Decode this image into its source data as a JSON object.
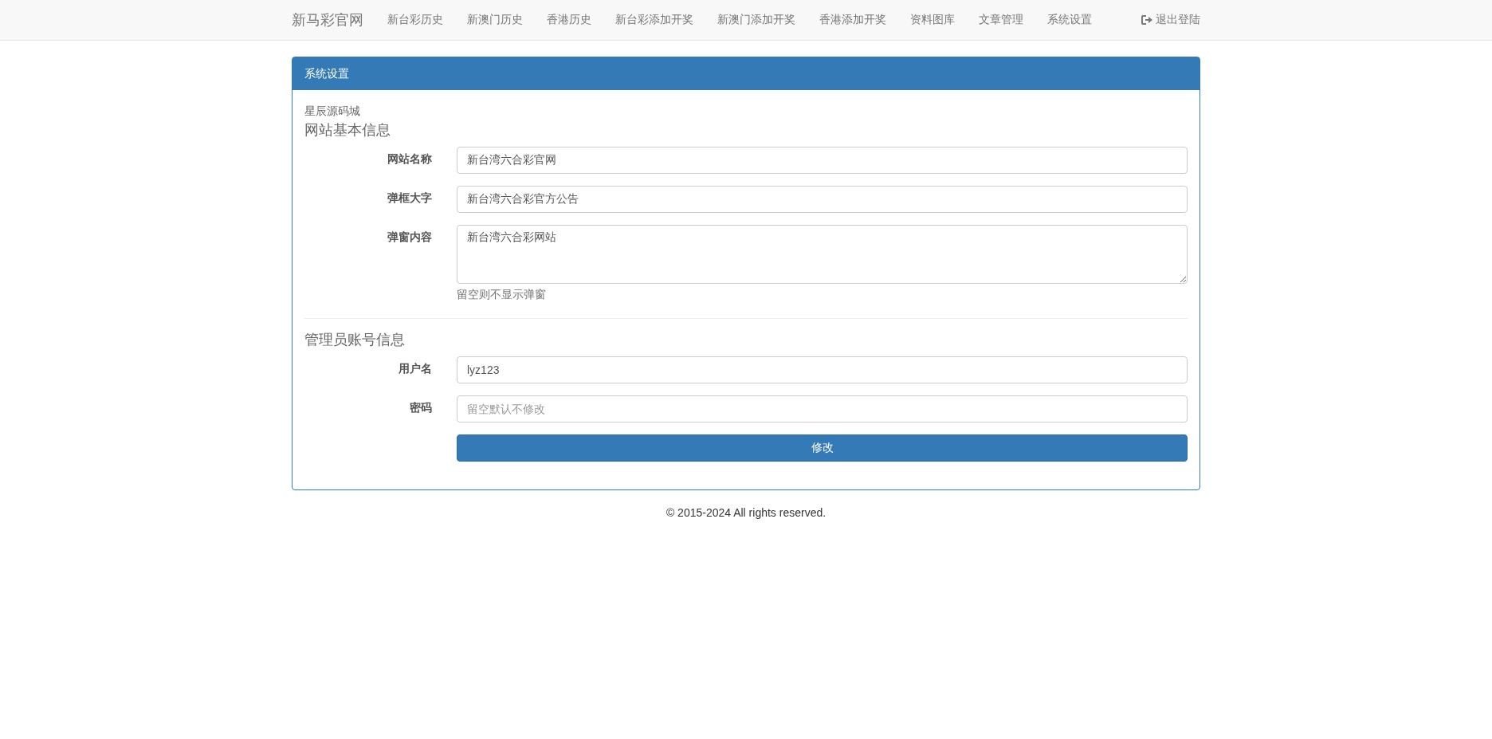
{
  "navbar": {
    "brand": "新马彩官网",
    "items": [
      {
        "label": "新台彩历史"
      },
      {
        "label": "新澳门历史"
      },
      {
        "label": "香港历史"
      },
      {
        "label": "新台彩添加开奖"
      },
      {
        "label": "新澳门添加开奖"
      },
      {
        "label": "香港添加开奖"
      },
      {
        "label": "资料图库"
      },
      {
        "label": "文章管理"
      },
      {
        "label": "系统设置"
      }
    ],
    "logout": "退出登陆"
  },
  "panel": {
    "title": "系统设置",
    "note": "星辰源码城",
    "sections": [
      {
        "heading": "网站基本信息",
        "fields": [
          {
            "label": "网站名称",
            "kind": "input",
            "value": "新台湾六合彩官网"
          },
          {
            "label": "弹框大字",
            "kind": "input",
            "value": "新台湾六合彩官方公告"
          },
          {
            "label": "弹窗内容",
            "kind": "textarea",
            "value": "新台湾六合彩网站",
            "help": "留空则不显示弹窗"
          }
        ]
      },
      {
        "heading": "管理员账号信息",
        "fields": [
          {
            "label": "用户名",
            "kind": "input",
            "value": "lyz123"
          },
          {
            "label": "密码",
            "kind": "input",
            "placeholder": "留空默认不修改"
          }
        ]
      }
    ],
    "submit": "修改"
  },
  "footer": "© 2015-2024 All rights reserved."
}
